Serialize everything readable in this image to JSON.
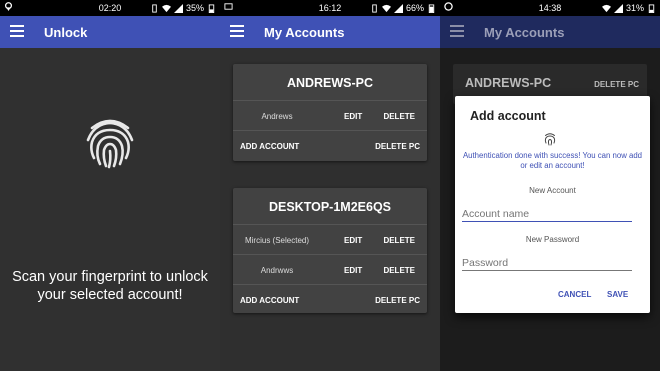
{
  "screen1": {
    "status": {
      "time": "02:20",
      "battery": "35%"
    },
    "title": "Unlock",
    "scan_text": "Scan your fingerprint to unlock your selected account!"
  },
  "screen2": {
    "status": {
      "time": "16:12",
      "battery": "66%"
    },
    "title": "My Accounts",
    "cards": [
      {
        "pc": "ANDREWS-PC",
        "accounts": [
          {
            "name": "Andrews",
            "edit": "EDIT",
            "delete": "DELETE"
          }
        ],
        "add_account": "ADD ACCOUNT",
        "delete_pc": "DELETE PC"
      },
      {
        "pc": "DESKTOP-1M2E6QS",
        "accounts": [
          {
            "name": "Mircius (Selected)",
            "edit": "EDIT",
            "delete": "DELETE"
          },
          {
            "name": "Andrwws",
            "edit": "EDIT",
            "delete": "DELETE"
          }
        ],
        "add_account": "ADD ACCOUNT",
        "delete_pc": "DELETE PC"
      }
    ]
  },
  "screen3": {
    "status": {
      "time": "14:38",
      "battery": "31%"
    },
    "title": "My Accounts",
    "bg_card": {
      "pc": "ANDREWS-PC",
      "delete_pc": "DELETE PC"
    },
    "dialog": {
      "title": "Add account",
      "auth_message": "Authentication done with success! You can now add or edit an account!",
      "new_account_label": "New Account",
      "account_placeholder": "Account name",
      "new_password_label": "New Password",
      "password_placeholder": "Password",
      "cancel": "CANCEL",
      "save": "SAVE"
    }
  },
  "colors": {
    "appbar": "#3f51b5",
    "accent": "#3f51b5",
    "card": "#424242",
    "background": "#303030"
  }
}
